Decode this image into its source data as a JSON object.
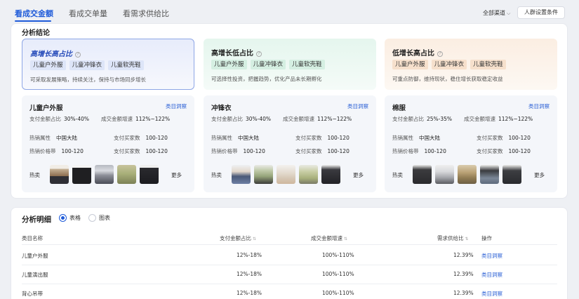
{
  "tabs": [
    {
      "label": "看成交金额",
      "active": true
    },
    {
      "label": "看成交单量",
      "active": false
    },
    {
      "label": "看需求供给比",
      "active": false
    }
  ],
  "toolbar": {
    "channel_label": "全部渠道",
    "settings_label": "人群设置条件"
  },
  "conclusion": {
    "title": "分析结论",
    "summaries": [
      {
        "title": "高增长高占比",
        "tags": [
          "儿童户外服",
          "儿童冲锋衣",
          "儿童软壳鞋"
        ],
        "desc": "可采取发展策略，持续关注，保持与市场同步增长",
        "color": "#8ea6e6"
      },
      {
        "title": "高增长低占比",
        "tags": [
          "儿童户外服",
          "儿童冲锋衣",
          "儿童软壳鞋"
        ],
        "desc": "可选择性投资，把握趋势，优化产品未长期孵化",
        "color": "#d5efe2"
      },
      {
        "title": "低增长高占比",
        "tags": [
          "儿童户外服",
          "儿童冲锋衣",
          "儿童软壳鞋"
        ],
        "desc": "可重点防御，维持现状，稳住增长获取稳定收益",
        "color": "#f6e0cc"
      }
    ],
    "cards": [
      {
        "title": "儿童户外服",
        "link": "类目洞察",
        "share_label": "支付金额占比",
        "share": "30%-40%",
        "growth_label": "成交金额增速",
        "growth": "112%~122%",
        "attr_label": "热销属性",
        "attr": "中国大陆",
        "buyers_label": "支付买家数",
        "buyers": "100-120",
        "price_label": "热销价格带",
        "price": "100-120",
        "buyers2_label": "支付买家数",
        "buyers2": "100-120",
        "hot_label": "热卖",
        "more_label": "更多"
      },
      {
        "title": "冲锋衣",
        "link": "类目洞察",
        "share_label": "支付金额占比",
        "share": "30%-40%",
        "growth_label": "成交金额增速",
        "growth": "112%~122%",
        "attr_label": "热销属性",
        "attr": "中国大陆",
        "buyers_label": "支付买家数",
        "buyers": "100-120",
        "price_label": "热销价格带",
        "price": "100-120",
        "buyers2_label": "支付买家数",
        "buyers2": "100-120",
        "hot_label": "热卖",
        "more_label": "更多"
      },
      {
        "title": "棉服",
        "link": "类目洞察",
        "share_label": "支付金额占比",
        "share": "25%-35%",
        "growth_label": "成交金额增速",
        "growth": "112%~122%",
        "attr_label": "热销属性",
        "attr": "中国大陆",
        "buyers_label": "支付买家数",
        "buyers": "100-120",
        "price_label": "热销价格带",
        "price": "100-120",
        "buyers2_label": "支付买家数",
        "buyers2": "100-120",
        "hot_label": "热卖",
        "more_label": "更多"
      }
    ]
  },
  "detail": {
    "title": "分析明细",
    "view_options": [
      {
        "label": "表格",
        "selected": true
      },
      {
        "label": "图表",
        "selected": false
      }
    ],
    "columns": [
      "类目名称",
      "支付金额占比",
      "成交金额增速",
      "需求供给比",
      "操作"
    ],
    "rows": [
      {
        "name": "儿童户外服",
        "share": "12%-18%",
        "growth": "100%-110%",
        "ratio": "12.39%",
        "action": "类目洞察"
      },
      {
        "name": "儿童演出服",
        "share": "12%-18%",
        "growth": "100%-110%",
        "ratio": "12.39%",
        "action": "类目洞察"
      },
      {
        "name": "背心吊带",
        "share": "12%-18%",
        "growth": "100%-110%",
        "ratio": "12.39%",
        "action": "类目洞察"
      }
    ]
  },
  "colors": {
    "accent": "#1f5bd9",
    "link": "#2f63d6"
  }
}
